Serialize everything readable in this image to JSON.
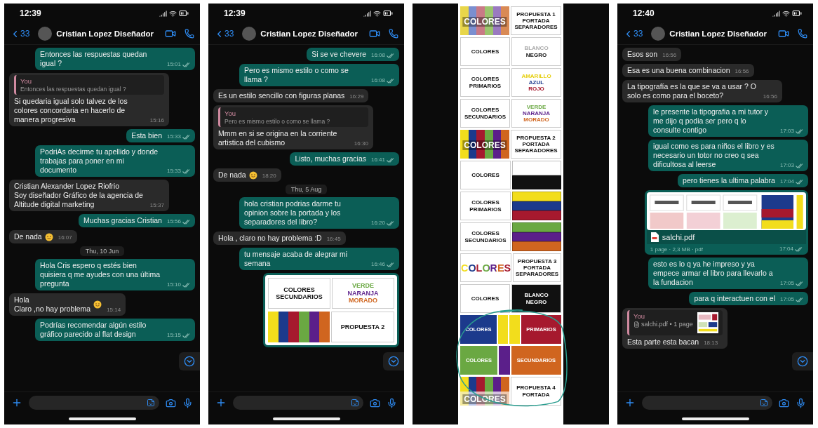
{
  "panels": [
    {
      "kind": "chat",
      "status_time": "12:39",
      "back_count": "33",
      "contact": "Cristian Lopez Diseñador",
      "scroll_down_button": true,
      "messages": [
        {
          "kind": "out",
          "text": "Entonces las respuestas quedan igual ?",
          "time": "15:01"
        },
        {
          "kind": "in",
          "quote": {
            "author": "You",
            "text": "Entonces las respuestas quedan igual ?"
          },
          "text": "Si quedaria igual solo talvez de los colores concordaria en hacerlo de manera progresiva",
          "time": "15:16"
        },
        {
          "kind": "out",
          "text": "Esta bien",
          "time": "15:33"
        },
        {
          "kind": "out",
          "text": "PodriAs decirme tu apellido y donde trabajas para poner en mi documento",
          "time": "15:33"
        },
        {
          "kind": "in",
          "text": "Cristian Alexander Lopez Riofrio\nSoy diseñador Gráfico de la agencia de Altitude digital marketing",
          "time": "15:37"
        },
        {
          "kind": "out",
          "text": "Muchas gracias Cristian",
          "time": "15:56"
        },
        {
          "kind": "in",
          "text": "De nada",
          "emoji": true,
          "time": "16:07"
        },
        {
          "kind": "date",
          "text": "Thu, 10 Jun"
        },
        {
          "kind": "out",
          "text": "Hola Cris espero q estés bien quisiera q me ayudes con una última pregunta",
          "time": "15:10"
        },
        {
          "kind": "in",
          "text": "Hola\nClaro ,no hay problema",
          "emoji": true,
          "time": "15:14"
        },
        {
          "kind": "out",
          "text": "Podrías recomendar algún estilo gráfico parecido al flat design",
          "time": "15:15"
        }
      ]
    },
    {
      "kind": "chat",
      "status_time": "12:39",
      "back_count": "33",
      "contact": "Cristian Lopez Diseñador",
      "scroll_down_button": true,
      "messages": [
        {
          "kind": "out",
          "text": "Si se ve chevere",
          "time": "16:08"
        },
        {
          "kind": "out",
          "text": "Pero es mismo estilo o como se llama ?",
          "time": "16:08"
        },
        {
          "kind": "in",
          "text": "Es un estilo sencillo con figuras planas",
          "time": "16:29"
        },
        {
          "kind": "in",
          "quote": {
            "author": "You",
            "text": "Pero es mismo estilo o como se llama ?"
          },
          "text": "Mmm en si se origina en la corriente artistica del cubismo",
          "time": "16:30"
        },
        {
          "kind": "out",
          "text": "Listo, muchas gracias",
          "time": "16:41"
        },
        {
          "kind": "in",
          "text": "De nada",
          "emoji": true,
          "time": "18:20"
        },
        {
          "kind": "date",
          "text": "Thu, 5 Aug"
        },
        {
          "kind": "out",
          "text": "hola cristian podrias darme tu opinion sobre la portada y los separadores del libro?",
          "time": "16:20"
        },
        {
          "kind": "in",
          "text": "Hola , claro no hay problema :D",
          "time": "16:45"
        },
        {
          "kind": "out",
          "text": "tu mensaje acaba de alegrar mi semana",
          "time": "16:46"
        },
        {
          "kind": "image",
          "rows": [
            {
              "tiles": [
                {
                  "kind": "words",
                  "lines": [
                    {
                      "text": "COLORES",
                      "color": "#111111"
                    },
                    {
                      "text": "SECUNDARIOS",
                      "color": "#111111"
                    }
                  ]
                },
                {
                  "kind": "words",
                  "lines": [
                    {
                      "text": "VERDE",
                      "color": "#6aa842"
                    },
                    {
                      "text": "NARANJA",
                      "color": "#5b1f8a"
                    },
                    {
                      "text": "MORADO",
                      "color": "#d0651f"
                    }
                  ]
                }
              ]
            },
            {
              "tiles": [
                {
                  "kind": "stripes",
                  "colors": [
                    {
                      "color": "#f2dd1c"
                    },
                    {
                      "color": "#1c3a8c"
                    },
                    {
                      "color": "#a6192e"
                    },
                    {
                      "color": "#6aa842"
                    },
                    {
                      "color": "#5b1f8a"
                    },
                    {
                      "color": "#d0651f"
                    }
                  ]
                },
                {
                  "kind": "words",
                  "lines": [
                    {
                      "text": "PROPUESTA 2",
                      "color": "#111111"
                    }
                  ]
                }
              ]
            }
          ]
        }
      ]
    },
    {
      "kind": "document",
      "rows": [
        {
          "tiles": [
            {
              "kind": "stripes",
              "colors": [
                {
                  "color": "#e8d64a"
                },
                {
                  "color": "#7b8fd0"
                },
                {
                  "color": "#c97a86"
                },
                {
                  "color": "#9cc46e"
                },
                {
                  "color": "#9a7ac0"
                },
                {
                  "color": "#d98a55"
                }
              ],
              "label": "COLORES"
            },
            {
              "kind": "words",
              "lines": [
                {
                  "text": "PROPUESTA 1",
                  "color": "#111111"
                },
                {
                  "text": "PORTADA",
                  "color": "#111111"
                },
                {
                  "text": "SEPARADORES",
                  "color": "#111111"
                }
              ]
            }
          ]
        },
        {
          "tiles": [
            {
              "kind": "words",
              "lines": [
                {
                  "text": "COLORES",
                  "color": "#111111"
                }
              ]
            },
            {
              "kind": "words",
              "lines": [
                {
                  "text": "BLANCO",
                  "color": "#aaaaaa"
                },
                {
                  "text": "NEGRO",
                  "color": "#111111"
                }
              ]
            }
          ]
        },
        {
          "tiles": [
            {
              "kind": "words",
              "lines": [
                {
                  "text": "COLORES",
                  "color": "#111111"
                },
                {
                  "text": "PRIMARIOS",
                  "color": "#111111"
                }
              ]
            },
            {
              "kind": "words",
              "lines": [
                {
                  "text": "AMARILLO",
                  "color": "#e6cf10"
                },
                {
                  "text": "AZUL",
                  "color": "#1c3a8c"
                },
                {
                  "text": "ROJO",
                  "color": "#a6192e"
                }
              ]
            }
          ]
        },
        {
          "tiles": [
            {
              "kind": "words",
              "lines": [
                {
                  "text": "COLORES",
                  "color": "#111111"
                },
                {
                  "text": "SECUNDARIOS",
                  "color": "#111111"
                }
              ]
            },
            {
              "kind": "words",
              "lines": [
                {
                  "text": "VERDE",
                  "color": "#6aa842"
                },
                {
                  "text": "NARANJA",
                  "color": "#5b1f8a"
                },
                {
                  "text": "MORADO",
                  "color": "#d0651f"
                }
              ]
            }
          ]
        },
        {
          "tiles": [
            {
              "kind": "stripes",
              "colors": [
                {
                  "color": "#f2dd1c"
                },
                {
                  "color": "#1c3a8c"
                },
                {
                  "color": "#a6192e"
                },
                {
                  "color": "#6aa842"
                },
                {
                  "color": "#5b1f8a"
                },
                {
                  "color": "#d0651f"
                }
              ],
              "label": "COLORES"
            },
            {
              "kind": "words",
              "lines": [
                {
                  "text": "PROPUESTA 2",
                  "color": "#111111"
                },
                {
                  "text": "PORTADA",
                  "color": "#111111"
                },
                {
                  "text": "SEPARADORES",
                  "color": "#111111"
                }
              ]
            }
          ]
        },
        {
          "tiles": [
            {
              "kind": "words",
              "lines": [
                {
                  "text": "COLORES",
                  "color": "#111111"
                }
              ]
            },
            {
              "kind": "bands",
              "colors": [
                {
                  "color": "#ffffff"
                },
                {
                  "color": "#111111"
                }
              ]
            }
          ]
        },
        {
          "tiles": [
            {
              "kind": "words",
              "lines": [
                {
                  "text": "COLORES",
                  "color": "#111111"
                },
                {
                  "text": "PRIMARIOS",
                  "color": "#111111"
                }
              ]
            },
            {
              "kind": "bands",
              "colors": [
                {
                  "color": "#f2dd1c"
                },
                {
                  "color": "#1c3a8c"
                },
                {
                  "color": "#a6192e"
                }
              ]
            }
          ]
        },
        {
          "tiles": [
            {
              "kind": "words",
              "lines": [
                {
                  "text": "COLORES",
                  "color": "#111111"
                },
                {
                  "text": "SECUNDARIOS",
                  "color": "#111111"
                }
              ]
            },
            {
              "kind": "bands",
              "colors": [
                {
                  "color": "#6aa842"
                },
                {
                  "color": "#5b1f8a"
                },
                {
                  "color": "#d0651f"
                }
              ]
            }
          ]
        },
        {
          "tiles": [
            {
              "kind": "letters",
              "text": "COLORES"
            },
            {
              "kind": "words",
              "lines": [
                {
                  "text": "PROPUESTA 3",
                  "color": "#111111"
                },
                {
                  "text": "PORTADA",
                  "color": "#111111"
                },
                {
                  "text": "SEPARADORES",
                  "color": "#111111"
                }
              ]
            }
          ]
        },
        {
          "tiles": [
            {
              "kind": "words",
              "lines": [
                {
                  "text": "COLORES",
                  "color": "#111111"
                }
              ]
            },
            {
              "kind": "inverse_words",
              "lines": [
                {
                  "text": "BLANCO",
                  "color": "#ffffff"
                },
                {
                  "text": "NEGRO",
                  "color": "#ffffff"
                }
              ]
            }
          ]
        },
        {
          "circled": true,
          "segments": [
            {
              "color": "#1c3a8c",
              "text": "COLORES"
            },
            {
              "color": "#f2dd1c"
            },
            {
              "color": "#f2dd1c"
            },
            {
              "color": "#a6192e",
              "text": "PRIMARIOS"
            }
          ]
        },
        {
          "circled": true,
          "segments": [
            {
              "color": "#6aa842",
              "text": "COLORES"
            },
            {
              "color": "#5b1f8a"
            },
            {
              "color": "#d0651f",
              "text": "SECUNDARIOS"
            }
          ]
        },
        {
          "circled": true,
          "tiles": [
            {
              "kind": "stripes",
              "colors": [
                {
                  "color": "#f2dd1c"
                },
                {
                  "color": "#1c3a8c"
                },
                {
                  "color": "#a6192e"
                },
                {
                  "color": "#6aa842"
                },
                {
                  "color": "#5b1f8a"
                },
                {
                  "color": "#d0651f"
                }
              ],
              "lower_colors": [
                {
                  "color": "#f4eaa0"
                },
                {
                  "color": "#b7c3e6"
                },
                {
                  "color": "#e4b7bd"
                },
                {
                  "color": "#cfe2b7"
                },
                {
                  "color": "#d6c2e3"
                },
                {
                  "color": "#f0c9ae"
                }
              ],
              "label": "COLORES"
            },
            {
              "kind": "words",
              "lines": [
                {
                  "text": "PROPUESTA 4",
                  "color": "#111111"
                },
                {
                  "text": "PORTADA",
                  "color": "#111111"
                }
              ]
            }
          ]
        }
      ]
    },
    {
      "kind": "chat",
      "status_time": "12:40",
      "back_count": "33",
      "contact": "Cristian Lopez Diseñador",
      "scroll_down_button": true,
      "messages": [
        {
          "kind": "in",
          "text": "Esos son",
          "time": "16:56"
        },
        {
          "kind": "in",
          "text": "Esa es una buena combinacion",
          "time": "16:56"
        },
        {
          "kind": "in",
          "text": "La tipografía es la que se va a usar ? O solo es como para el boceto?",
          "time": "16:56"
        },
        {
          "kind": "out",
          "text": "le presente la tipografia a mi tutor y me dijo q podia ser pero q lo consulte contigo",
          "time": "17:03"
        },
        {
          "kind": "out",
          "text": "igual como es para niños el libro y es necesario un totor no creo q sea dificultosa al leerse",
          "time": "17:03"
        },
        {
          "kind": "out",
          "text": "pero tienes la ultima palabra",
          "time": "17:04"
        },
        {
          "kind": "file",
          "name": "salchi.pdf",
          "meta": "1 page · 2,3 MB · pdf",
          "time": "17:04"
        },
        {
          "kind": "out",
          "text": "esto es lo q ya he impreso y ya empece armar el libro para llevarlo a la fundacion",
          "time": "17:05"
        },
        {
          "kind": "out",
          "text": "para q interactuen con el",
          "time": "17:05"
        },
        {
          "kind": "in",
          "quote": {
            "author": "You",
            "file": "salchi.pdf • 1 page"
          },
          "text": "Esta parte esta bacan",
          "time": "18:13"
        }
      ]
    }
  ]
}
